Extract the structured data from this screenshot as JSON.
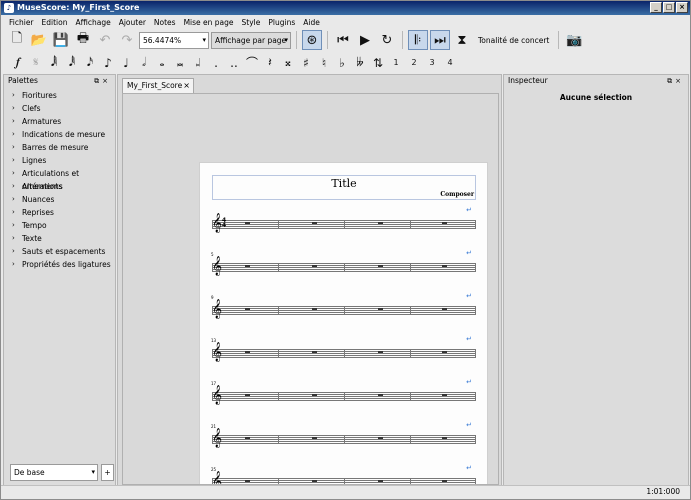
{
  "window": {
    "title": "MuseScore: My_First_Score",
    "min": "_",
    "max": "□",
    "close": "×"
  },
  "menus": [
    "Fichier",
    "Edition",
    "Affichage",
    "Ajouter",
    "Notes",
    "Mise en page",
    "Style",
    "Plugins",
    "Aide"
  ],
  "toolbar": {
    "zoom": "56.4474%",
    "view_mode": "Affichage par page",
    "concert_pitch": "Tonalité de concert"
  },
  "note_input": {
    "voices": [
      "1",
      "2",
      "3",
      "4"
    ]
  },
  "palettes": {
    "title": "Palettes",
    "items": [
      "Fioritures",
      "Clefs",
      "Armatures",
      "Indications de mesure",
      "Barres de mesure",
      "Lignes",
      "Articulations et ornements",
      "Altérations",
      "Nuances",
      "Reprises",
      "Tempo",
      "Texte",
      "Sauts et espacements",
      "Propriétés des ligatures"
    ],
    "workspace": "De base",
    "add_label": "+"
  },
  "tab": {
    "label": "My_First_Score",
    "close": "×"
  },
  "score": {
    "title": "Title",
    "composer": "Composer",
    "measure_numbers": [
      "5",
      "9",
      "13",
      "17",
      "21",
      "25"
    ]
  },
  "inspector": {
    "title": "Inspecteur",
    "empty": "Aucune sélection"
  },
  "status": {
    "position": "1:01:000"
  }
}
